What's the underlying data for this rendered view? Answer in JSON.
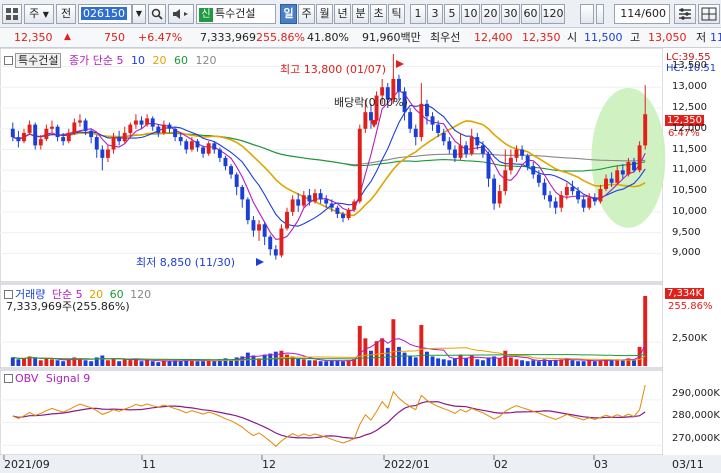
{
  "toolbar": {
    "menu_icon": "grid-menu-icon",
    "type_select": "주",
    "prev_label": "전",
    "code": "026150",
    "stock_name": "특수건설",
    "stock_badge": "신",
    "period_tabs": [
      "일",
      "주",
      "월",
      "년",
      "분",
      "초",
      "틱"
    ],
    "active_period": "일",
    "intervals": [
      "1",
      "3",
      "5",
      "10",
      "20",
      "30",
      "60",
      "120"
    ],
    "count": "114",
    "count_total": "/600"
  },
  "quote": {
    "price": "12,350",
    "change": "750",
    "change_pct": "+6.47%",
    "volume": "7,333,969",
    "volume_pct": "255.86%",
    "turnover": "41.80%",
    "amount": "91,960백만",
    "best_bid_label": "최우선",
    "best_ask": "12,400",
    "best_bid": "12,350",
    "open_label": "시",
    "open": "11,500",
    "high_label": "고",
    "high": "13,050",
    "low_label": "저",
    "low": "11,5"
  },
  "price_panel": {
    "stock_label": "특수건설",
    "ma_legend_prefix": "종가 단순",
    "ma_periods": [
      "5",
      "10",
      "20",
      "60",
      "120"
    ],
    "ma_colors": [
      "#b01ebf",
      "#1a3fd6",
      "#e0a500",
      "#1a9a3a",
      "#888888"
    ],
    "lc_label": "LC:39.55",
    "hc_label": "HC:-10.51",
    "current_price_box": "12,350",
    "current_pct_box": "6.47%",
    "annotation_high": "최고 13,800 (01/07)",
    "annotation_low": "최저 8,850 (11/30)",
    "annotation_dividend": "배당락(0.00%)",
    "y_ticks": [
      "13,500",
      "13,000",
      "12,500",
      "12,000",
      "11,500",
      "11,000",
      "10,500",
      "10,000",
      "9,500",
      "9,000"
    ]
  },
  "volume_panel": {
    "label": "거래량",
    "ma_prefix": "단순",
    "ma_periods": [
      "5",
      "20",
      "60",
      "120"
    ],
    "value_line": "7,333,969주(255.86%)",
    "box_value": "7,334K",
    "box_pct": "255.86%",
    "y_ticks": [
      "5,000K",
      "2,500K"
    ]
  },
  "obv_panel": {
    "label": "OBV",
    "signal_label": "Signal 9",
    "y_ticks": [
      "290,000K",
      "280,000K",
      "270,000K"
    ]
  },
  "x_axis": {
    "labels": [
      "2021/09",
      "11",
      "12",
      "2022/01",
      "02",
      "03",
      "03/11"
    ]
  },
  "colors": {
    "up": "#e0201b",
    "down": "#1a3fd6",
    "highlight": "#c8f0b8"
  },
  "chart_data": {
    "type": "candlestick",
    "y_range": [
      8600,
      13800
    ],
    "candles": [
      [
        12000,
        11800,
        12150,
        11700
      ],
      [
        11800,
        11700,
        11950,
        11550
      ],
      [
        11700,
        11900,
        12000,
        11650
      ],
      [
        11900,
        12100,
        12200,
        11850
      ],
      [
        12100,
        11600,
        12150,
        11500
      ],
      [
        11600,
        11750,
        11850,
        11500
      ],
      [
        11750,
        12000,
        12100,
        11700
      ],
      [
        12000,
        12050,
        12200,
        11900
      ],
      [
        12050,
        11800,
        12100,
        11700
      ],
      [
        11800,
        11700,
        11900,
        11600
      ],
      [
        11700,
        11900,
        12000,
        11650
      ],
      [
        11900,
        12150,
        12250,
        11850
      ],
      [
        12150,
        12200,
        12350,
        12050
      ],
      [
        12200,
        11950,
        12250,
        11850
      ],
      [
        11950,
        11800,
        12000,
        11650
      ],
      [
        11800,
        11500,
        11850,
        11300
      ],
      [
        11500,
        11300,
        11600,
        11000
      ],
      [
        11300,
        11500,
        11600,
        11200
      ],
      [
        11500,
        11800,
        11900,
        11400
      ],
      [
        11800,
        11700,
        11950,
        11600
      ],
      [
        11700,
        11900,
        12050,
        11650
      ],
      [
        11900,
        12100,
        12150,
        11800
      ],
      [
        12100,
        12200,
        12350,
        12000
      ],
      [
        12200,
        12100,
        12300,
        12000
      ],
      [
        12100,
        12250,
        12350,
        12050
      ],
      [
        12250,
        12050,
        12300,
        11950
      ],
      [
        12050,
        11900,
        12100,
        11800
      ],
      [
        11900,
        12100,
        12200,
        11850
      ],
      [
        12100,
        12000,
        12150,
        11900
      ],
      [
        12000,
        11800,
        12050,
        11700
      ],
      [
        11800,
        11700,
        11900,
        11600
      ],
      [
        11700,
        11500,
        11750,
        11400
      ],
      [
        11500,
        11700,
        11800,
        11450
      ],
      [
        11700,
        11550,
        11750,
        11450
      ],
      [
        11550,
        11400,
        11600,
        11300
      ],
      [
        11400,
        11650,
        11700,
        11350
      ],
      [
        11650,
        11500,
        11700,
        11400
      ],
      [
        11500,
        11300,
        11550,
        11200
      ],
      [
        11300,
        11100,
        11350,
        11000
      ],
      [
        11100,
        10900,
        11150,
        10800
      ],
      [
        10900,
        10600,
        10950,
        10400
      ],
      [
        10600,
        10300,
        10650,
        10100
      ],
      [
        10300,
        9800,
        10350,
        9700
      ],
      [
        9800,
        9550,
        9900,
        9400
      ],
      [
        9550,
        9700,
        9800,
        9300
      ],
      [
        9700,
        9400,
        9750,
        9200
      ],
      [
        9400,
        9100,
        9450,
        8950
      ],
      [
        9100,
        8950,
        9200,
        8850
      ],
      [
        8950,
        9600,
        9700,
        8900
      ],
      [
        9600,
        10000,
        10100,
        9550
      ],
      [
        10000,
        10300,
        10400,
        9900
      ],
      [
        10300,
        10150,
        10450,
        10000
      ],
      [
        10150,
        10400,
        10500,
        10100
      ],
      [
        10400,
        10250,
        10550,
        10150
      ],
      [
        10250,
        10450,
        10550,
        10200
      ],
      [
        10450,
        10300,
        10550,
        10200
      ],
      [
        10300,
        10200,
        10400,
        10100
      ],
      [
        10200,
        10100,
        10300,
        10000
      ],
      [
        10100,
        9950,
        10150,
        9850
      ],
      [
        9950,
        9850,
        10000,
        9750
      ],
      [
        9850,
        10050,
        10100,
        9800
      ],
      [
        10050,
        10250,
        10300,
        10000
      ],
      [
        10250,
        12000,
        12100,
        10200
      ],
      [
        12000,
        12400,
        12700,
        11900
      ],
      [
        12400,
        12200,
        12600,
        12000
      ],
      [
        12200,
        12800,
        12900,
        12100
      ],
      [
        12800,
        13000,
        13200,
        12600
      ],
      [
        13000,
        12700,
        13100,
        12500
      ],
      [
        12700,
        13200,
        13800,
        12600
      ],
      [
        13200,
        12900,
        13300,
        12700
      ],
      [
        12900,
        12400,
        13000,
        12200
      ],
      [
        12400,
        12000,
        12500,
        11900
      ],
      [
        12000,
        11800,
        12100,
        11600
      ],
      [
        11800,
        12600,
        13100,
        11700
      ],
      [
        12600,
        12300,
        12700,
        12100
      ],
      [
        12300,
        12100,
        12400,
        11950
      ],
      [
        12100,
        11900,
        12200,
        11800
      ],
      [
        11900,
        11700,
        12000,
        11600
      ],
      [
        11700,
        11500,
        11800,
        11400
      ],
      [
        11500,
        11300,
        11600,
        11200
      ],
      [
        11300,
        11600,
        11900,
        11250
      ],
      [
        11600,
        11400,
        11700,
        11300
      ],
      [
        11400,
        11800,
        12000,
        11350
      ],
      [
        11800,
        11600,
        11900,
        11500
      ],
      [
        11600,
        11400,
        11700,
        11300
      ],
      [
        11400,
        10800,
        11450,
        10600
      ],
      [
        10800,
        10200,
        10900,
        10050
      ],
      [
        10200,
        10500,
        10650,
        10100
      ],
      [
        10500,
        11000,
        11500,
        10400
      ],
      [
        11000,
        11300,
        11500,
        10900
      ],
      [
        11300,
        11500,
        11600,
        11200
      ],
      [
        11500,
        11350,
        11600,
        11250
      ],
      [
        11350,
        11100,
        11400,
        11000
      ],
      [
        11100,
        10900,
        11200,
        10800
      ],
      [
        10900,
        10700,
        11000,
        10600
      ],
      [
        10700,
        10400,
        10800,
        10300
      ],
      [
        10400,
        10250,
        10500,
        10100
      ],
      [
        10250,
        10100,
        10350,
        9950
      ],
      [
        10100,
        10400,
        10500,
        10000
      ],
      [
        10400,
        10600,
        10700,
        10300
      ],
      [
        10600,
        10500,
        10750,
        10400
      ],
      [
        10500,
        10300,
        10600,
        10200
      ],
      [
        10300,
        10100,
        10400,
        10000
      ],
      [
        10100,
        10350,
        10450,
        10050
      ],
      [
        10350,
        10250,
        10450,
        10150
      ],
      [
        10250,
        10550,
        10650,
        10200
      ],
      [
        10550,
        10800,
        10900,
        10500
      ],
      [
        10800,
        10700,
        10950,
        10600
      ],
      [
        10700,
        11000,
        11100,
        10650
      ],
      [
        11000,
        10900,
        11150,
        10800
      ],
      [
        10900,
        11200,
        11300,
        10850
      ],
      [
        11200,
        11000,
        11300,
        10950
      ],
      [
        11000,
        11600,
        11700,
        10950
      ],
      [
        11600,
        12350,
        13050,
        11500
      ]
    ],
    "volume": [
      0.9,
      0.7,
      0.8,
      1.0,
      0.9,
      0.6,
      0.8,
      0.7,
      0.6,
      0.5,
      0.7,
      0.9,
      0.8,
      0.6,
      0.5,
      0.9,
      1.1,
      0.6,
      0.8,
      0.5,
      0.7,
      0.6,
      0.8,
      0.5,
      0.6,
      0.5,
      0.4,
      0.6,
      0.5,
      0.6,
      0.5,
      0.7,
      0.6,
      0.5,
      0.5,
      0.6,
      0.5,
      0.7,
      0.8,
      0.6,
      0.9,
      1.0,
      1.4,
      1.1,
      0.8,
      1.2,
      1.3,
      1.5,
      1.6,
      1.2,
      1.0,
      0.8,
      0.7,
      0.6,
      0.6,
      0.5,
      0.5,
      0.6,
      0.6,
      0.5,
      0.6,
      0.7,
      4.2,
      2.9,
      1.6,
      2.6,
      2.9,
      1.9,
      4.9,
      2.0,
      1.4,
      1.1,
      0.9,
      4.3,
      1.5,
      1.0,
      0.8,
      0.7,
      0.6,
      0.8,
      1.2,
      0.8,
      1.1,
      0.7,
      0.6,
      0.9,
      1.0,
      0.8,
      1.6,
      0.9,
      0.7,
      0.6,
      0.5,
      0.6,
      0.5,
      0.7,
      0.6,
      0.6,
      0.7,
      0.8,
      0.6,
      0.5,
      0.5,
      0.6,
      0.5,
      0.6,
      0.7,
      0.6,
      0.7,
      0.6,
      0.8,
      0.7,
      2.0,
      7.33
    ]
  }
}
